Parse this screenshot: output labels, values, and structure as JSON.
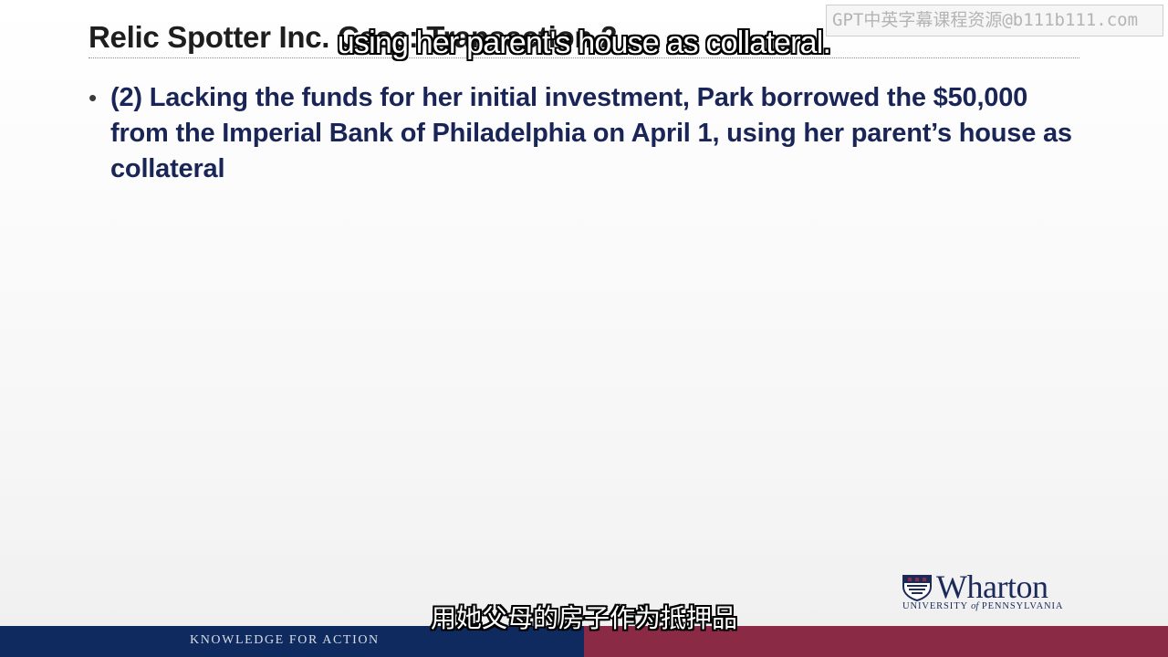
{
  "slide": {
    "title": "Relic Spotter Inc. Case: Transaction 2",
    "bullet": {
      "marker": "•",
      "text": "(2) Lacking the funds for her initial investment, Park borrowed the $50,000 from the Imperial Bank of Philadelphia on April 1, using her parent’s house as collateral"
    }
  },
  "overlay": {
    "watermark": "GPT中英字幕课程资源@b111b111.com",
    "subtitle_en": "using her parent's house as collateral.",
    "subtitle_zh": "用她父母的房子作为抵押品"
  },
  "branding": {
    "logo_word": "Wharton",
    "logo_sub_1": "UNIVERSITY",
    "logo_sub_of": "of",
    "logo_sub_2": "PENNSYLVANIA",
    "tagline": "KNOWLEDGE FOR ACTION"
  },
  "colors": {
    "title": "#1e1e1e",
    "bullet_text": "#1a2557",
    "footer_left": "#0f2a5e",
    "footer_right": "#8a2a44",
    "logo": "#1b2a5a"
  }
}
